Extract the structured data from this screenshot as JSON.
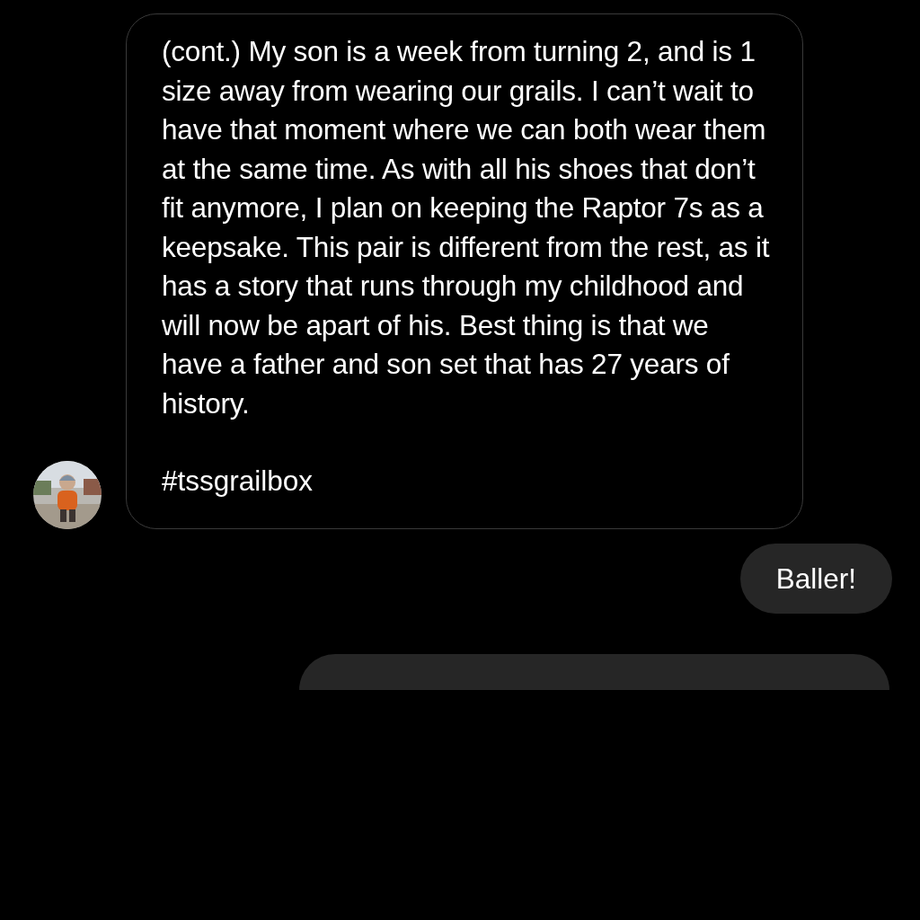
{
  "messages": [
    {
      "kind": "received",
      "text": "(cont.) My son is a week from turning 2, and is 1 size away from wearing our grails. I can’t wait to have that moment where we can both wear them at the same time. As with all his shoes that don’t fit anymore, I plan on keeping the Raptor 7s as a keepsake. This pair is different from the rest, as it has a story that runs through my childhood and will now be apart of his. Best thing is that we have a father and son set that has 27 years of history.",
      "hashtag": "#tssgrailbox"
    },
    {
      "kind": "sent",
      "text": "Baller!"
    },
    {
      "kind": "sent_partial"
    }
  ]
}
